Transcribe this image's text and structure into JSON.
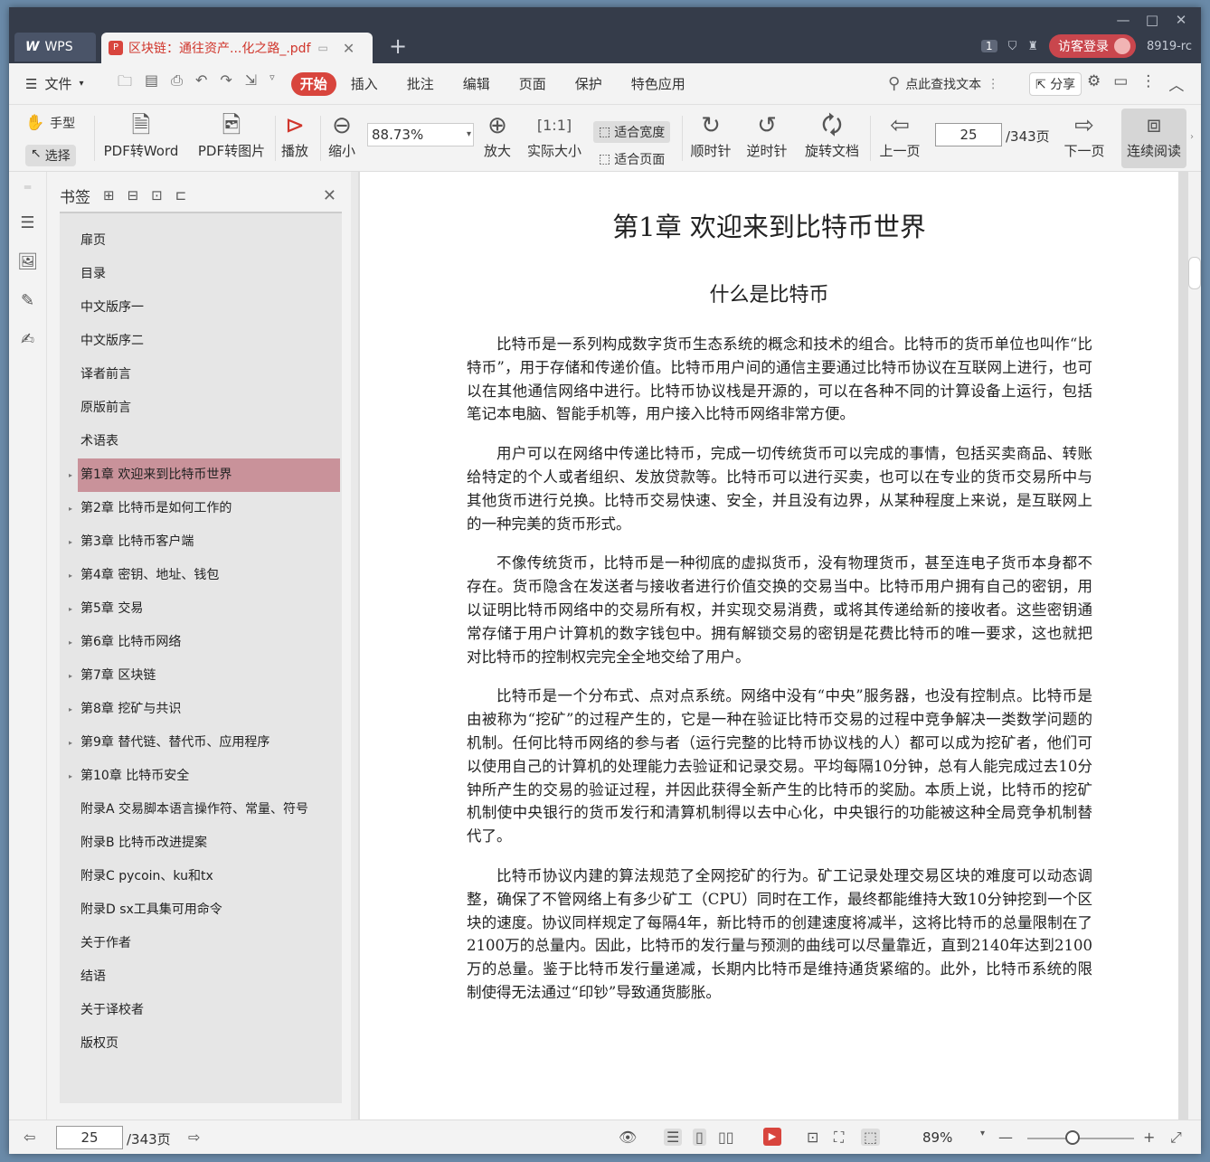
{
  "window": {
    "controls": [
      "—",
      "□",
      "✕"
    ]
  },
  "tabs": {
    "wps_label": "WPS",
    "doc_title": "区块链：通往资产...化之路_.pdf",
    "new_tab": "+"
  },
  "topright": {
    "badge": "1",
    "login_label": "访客登录",
    "user_id": "8919-rc"
  },
  "menu": {
    "file_label": "文件",
    "tabs": [
      "开始",
      "插入",
      "批注",
      "编辑",
      "页面",
      "保护",
      "特色应用"
    ],
    "search_label": "点此查找文本",
    "share_label": "分享"
  },
  "toolbar": {
    "hand_label": "手型",
    "select_label": "选择",
    "pdf_to_word": "PDF转Word",
    "pdf_to_image": "PDF转图片",
    "play": "播放",
    "zoom_out": "缩小",
    "zoom_value": "88.73%",
    "zoom_in": "放大",
    "actual_size": "实际大小",
    "fit_width": "适合宽度",
    "fit_page": "适合页面",
    "clockwise": "顺时针",
    "counterclockwise": "逆时针",
    "rotate_doc": "旋转文档",
    "prev_page": "上一页",
    "page_value": "25",
    "page_total": "/343页",
    "next_page": "下一页",
    "continuous_read": "连续阅读"
  },
  "bookmarks": {
    "title": "书签",
    "items": [
      {
        "label": "扉页",
        "expandable": false
      },
      {
        "label": "目录",
        "expandable": false
      },
      {
        "label": "中文版序一",
        "expandable": false
      },
      {
        "label": "中文版序二",
        "expandable": false
      },
      {
        "label": "译者前言",
        "expandable": false
      },
      {
        "label": "原版前言",
        "expandable": false
      },
      {
        "label": "术语表",
        "expandable": false
      },
      {
        "label": "第1章 欢迎来到比特币世界",
        "expandable": true,
        "selected": true
      },
      {
        "label": "第2章 比特币是如何工作的",
        "expandable": true
      },
      {
        "label": "第3章 比特币客户端",
        "expandable": true
      },
      {
        "label": "第4章 密钥、地址、钱包",
        "expandable": true
      },
      {
        "label": "第5章 交易",
        "expandable": true
      },
      {
        "label": "第6章 比特币网络",
        "expandable": true
      },
      {
        "label": "第7章 区块链",
        "expandable": true
      },
      {
        "label": "第8章 挖矿与共识",
        "expandable": true
      },
      {
        "label": "第9章 替代链、替代币、应用程序",
        "expandable": true
      },
      {
        "label": "第10章 比特币安全",
        "expandable": true
      },
      {
        "label": "附录A 交易脚本语言操作符、常量、符号",
        "expandable": false
      },
      {
        "label": "附录B 比特币改进提案",
        "expandable": false
      },
      {
        "label": "附录C pycoin、ku和tx",
        "expandable": false
      },
      {
        "label": "附录D sx工具集可用命令",
        "expandable": false
      },
      {
        "label": "关于作者",
        "expandable": false
      },
      {
        "label": "结语",
        "expandable": false
      },
      {
        "label": "关于译校者",
        "expandable": false
      },
      {
        "label": "版权页",
        "expandable": false
      }
    ]
  },
  "document": {
    "chapter_title": "第1章 欢迎来到比特币世界",
    "section_title": "什么是比特币",
    "paragraphs": [
      "比特币是一系列构成数字货币生态系统的概念和技术的组合。比特币的货币单位也叫作“比特币”，用于存储和传递价值。比特币用户间的通信主要通过比特币协议在互联网上进行，也可以在其他通信网络中进行。比特币协议栈是开源的，可以在各种不同的计算设备上运行，包括笔记本电脑、智能手机等，用户接入比特币网络非常方便。",
      "用户可以在网络中传递比特币，完成一切传统货币可以完成的事情，包括买卖商品、转账给特定的个人或者组织、发放贷款等。比特币可以进行买卖，也可以在专业的货币交易所中与其他货币进行兑换。比特币交易快速、安全，并且没有边界，从某种程度上来说，是互联网上的一种完美的货币形式。",
      "不像传统货币，比特币是一种彻底的虚拟货币，没有物理货币，甚至连电子货币本身都不存在。货币隐含在发送者与接收者进行价值交换的交易当中。比特币用户拥有自己的密钥，用以证明比特币网络中的交易所有权，并实现交易消费，或将其传递给新的接收者。这些密钥通常存储于用户计算机的数字钱包中。拥有解锁交易的密钥是花费比特币的唯一要求，这也就把对比特币的控制权完完全全地交给了用户。",
      "比特币是一个分布式、点对点系统。网络中没有“中央”服务器，也没有控制点。比特币是由被称为“挖矿”的过程产生的，它是一种在验证比特币交易的过程中竞争解决一类数学问题的机制。任何比特币网络的参与者（运行完整的比特币协议栈的人）都可以成为挖矿者，他们可以使用自己的计算机的处理能力去验证和记录交易。平均每隔10分钟，总有人能完成过去10分钟所产生的交易的验证过程，并因此获得全新产生的比特币的奖励。本质上说，比特币的挖矿机制使中央银行的货币发行和清算机制得以去中心化，中央银行的功能被这种全局竞争机制替代了。",
      "比特币协议内建的算法规范了全网挖矿的行为。矿工记录处理交易区块的难度可以动态调整，确保了不管网络上有多少矿工（CPU）同时在工作，最终都能维持大致10分钟挖到一个区块的速度。协议同样规定了每隔4年，新比特币的创建速度将减半，这将比特币的总量限制在了2100万的总量内。因此，比特币的发行量与预测的曲线可以尽量靠近，直到2140年达到2100万的总量。鉴于比特币发行量递减，长期内比特币是维持通货紧缩的。此外，比特币系统的限制使得无法通过“印钞”导致通货膨胀。"
    ]
  },
  "status": {
    "page_value": "25",
    "page_total": "/343页",
    "zoom": "89%"
  }
}
